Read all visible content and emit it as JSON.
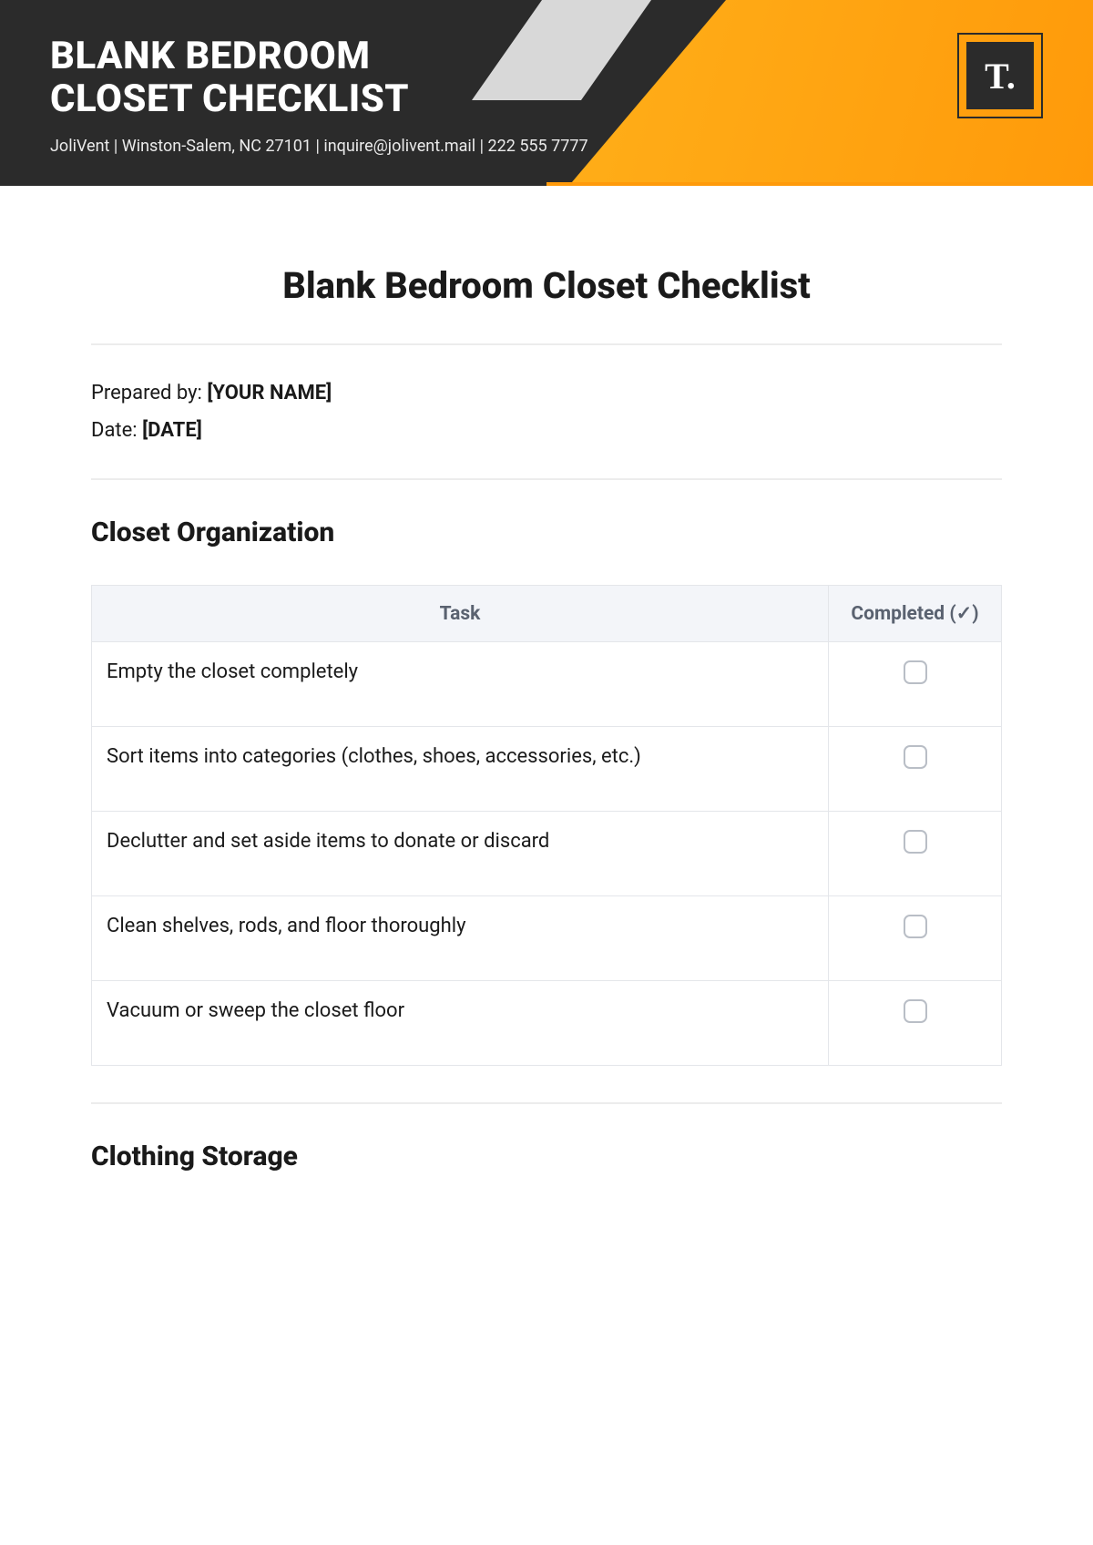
{
  "header": {
    "title_line1": "BLANK BEDROOM",
    "title_line2": "CLOSET CHECKLIST",
    "contact_line": "JoliVent | Winston-Salem, NC 27101 | inquire@jolivent.mail | 222 555 7777",
    "logo_text": "T."
  },
  "document": {
    "title": "Blank Bedroom Closet Checklist",
    "prepared_by_label": "Prepared by: ",
    "prepared_by_value": "[YOUR NAME]",
    "date_label": "Date: ",
    "date_value": "[DATE]"
  },
  "table_headers": {
    "task": "Task",
    "completed": "Completed (✓)"
  },
  "sections": [
    {
      "title": "Closet Organization",
      "tasks": [
        "Empty the closet completely",
        "Sort items into categories (clothes, shoes, accessories, etc.)",
        "Declutter and set aside items to donate or discard",
        "Clean shelves, rods, and floor thoroughly",
        "Vacuum or sweep the closet floor"
      ]
    },
    {
      "title": "Clothing Storage",
      "tasks": []
    }
  ]
}
